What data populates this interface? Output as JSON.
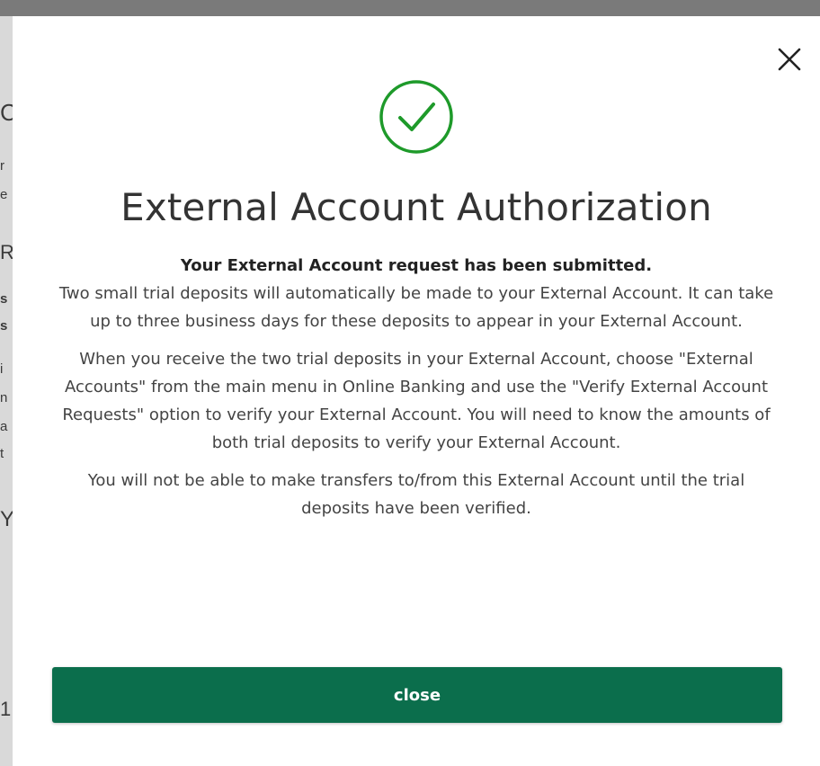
{
  "background": {
    "fragments": [
      "C",
      "r",
      "e",
      "R",
      "s",
      "s",
      "i",
      "n",
      "a",
      "t",
      "Y",
      "1"
    ]
  },
  "modal": {
    "close_icon": "close-icon",
    "success_icon": "check-circle-icon",
    "title": "External Account Authorization",
    "lead": "Your External Account request has been submitted.",
    "paragraph1": "Two small trial deposits will automatically be made to your External Account. It can take up to three business days for these deposits to appear in your External Account.",
    "paragraph2": "When you receive the two trial deposits in your External Account, choose \"External Accounts\" from the main menu in Online Banking and use the \"Verify External Account Requests\" option to verify your External Account. You will need to know the amounts of both trial deposits to verify your External Account.",
    "paragraph3": "You will not be able to make transfers to/from this External Account until the trial deposits have been verified.",
    "close_button_label": "close"
  },
  "colors": {
    "success_green": "#1e9a2a",
    "button_green": "#0b6e4c",
    "title_text": "#333333"
  }
}
